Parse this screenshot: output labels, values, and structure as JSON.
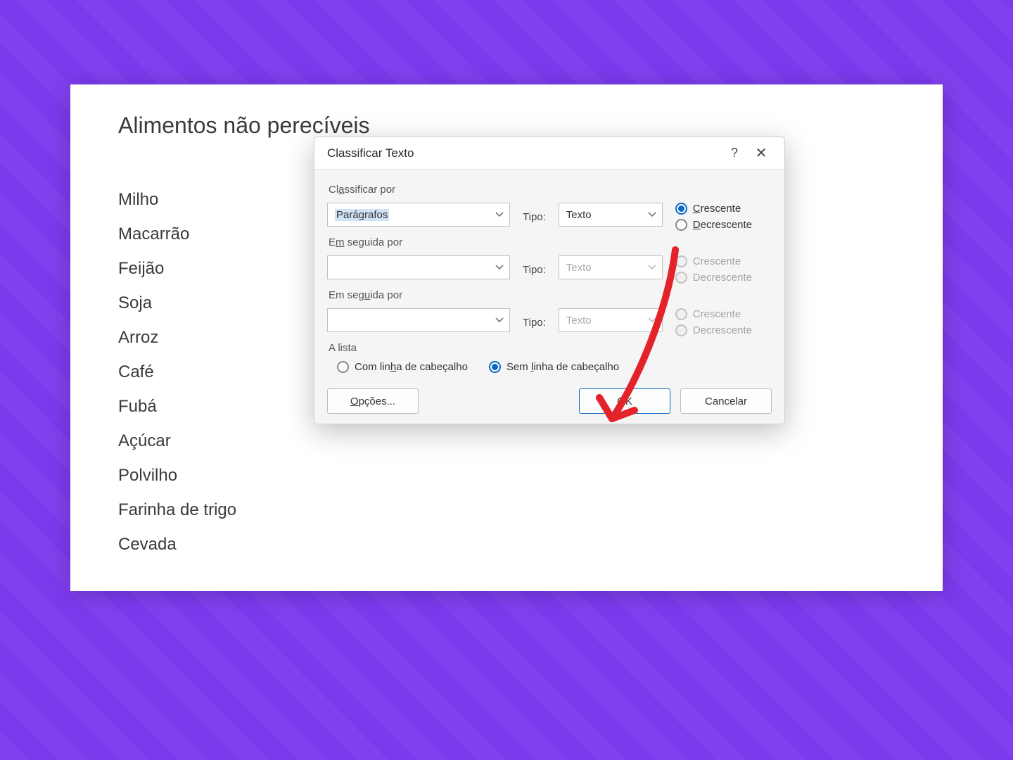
{
  "document": {
    "title": "Alimentos não perecíveis",
    "items": [
      "Milho",
      "Macarrão",
      "Feijão",
      "Soja",
      "Arroz",
      "Café",
      "Fubá",
      "Açúcar",
      "Polvilho",
      "Farinha de trigo",
      "Cevada"
    ]
  },
  "dialog": {
    "title": "Classificar Texto",
    "help_label": "?",
    "close_label": "✕",
    "sort_by_label_pre": "Cl",
    "sort_by_label_ul": "a",
    "sort_by_label_post": "ssificar por",
    "then_by1_pre": "E",
    "then_by1_ul": "m",
    "then_by1_post": " seguida por",
    "then_by2_pre": "Em seg",
    "then_by2_ul": "u",
    "then_by2_post": "ida por",
    "tipo_label": "Tipo:",
    "sort1": {
      "field": "Parágrafos",
      "type": "Texto"
    },
    "sort2": {
      "field": "",
      "type": "Texto"
    },
    "sort3": {
      "field": "",
      "type": "Texto"
    },
    "asc_ul": "C",
    "asc_post": "rescente",
    "desc_ul": "D",
    "desc_post": "ecrescente",
    "asc_plain": "Crescente",
    "desc_plain": "Decrescente",
    "list_label": "A lista",
    "with_header_pre": "Com lin",
    "with_header_ul": "h",
    "with_header_post": "a de cabeçalho",
    "without_header_pre": "Sem ",
    "without_header_ul": "l",
    "without_header_post": "inha de cabeçalho",
    "options_ul": "O",
    "options_post": "pções...",
    "ok_label": "OK",
    "cancel_label": "Cancelar"
  }
}
